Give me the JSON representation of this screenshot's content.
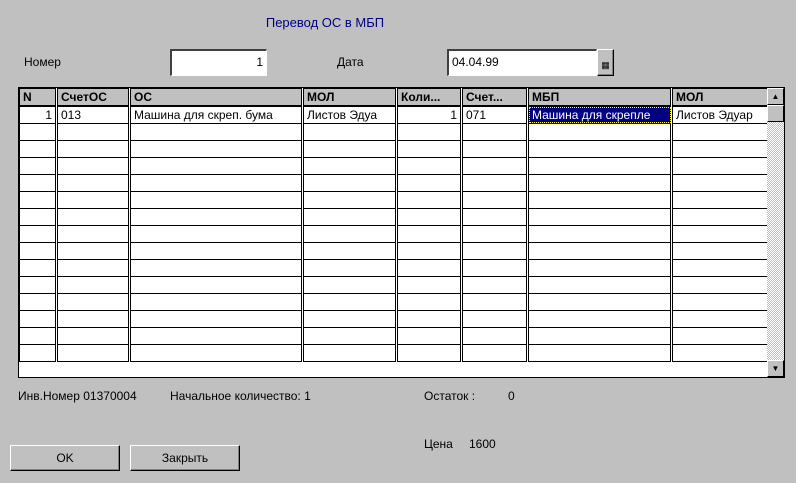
{
  "title": "Перевод ОС в МБП",
  "form": {
    "number_label": "Номер",
    "number_value": "1",
    "date_label": "Дата",
    "date_value": "04.04.99"
  },
  "grid": {
    "columns": [
      "N",
      "СчетОС",
      "ОС",
      "МОЛ",
      "Коли...",
      "Счет...",
      "МБП",
      "МОЛ"
    ],
    "rows": [
      [
        "1",
        "013",
        "Машина для скреп. бума",
        "Листов Эдуа",
        "1",
        "071",
        "Машина для скрепле",
        "Листов Эдуар"
      ]
    ],
    "empty_rows": 14
  },
  "info": {
    "inv_label": "Инв.Номер",
    "inv_value": "01370004",
    "initial_qty_label": "Начальное количество:",
    "initial_qty_value": "1",
    "remainder_label": "Остаток :",
    "remainder_value": "0",
    "price_label": "Цена",
    "price_value": "1600"
  },
  "buttons": {
    "ok": "OK",
    "close": "Закрыть"
  }
}
